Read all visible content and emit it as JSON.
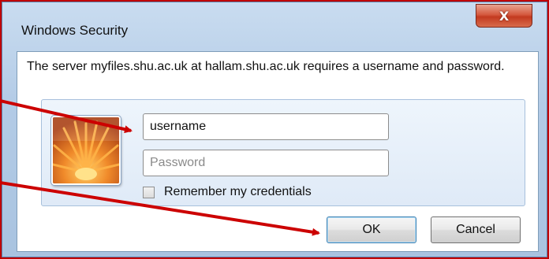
{
  "window": {
    "title": "Windows Security",
    "close_glyph": "X"
  },
  "message": "The server myfiles.shu.ac.uk at hallam.shu.ac.uk requires a username and password.",
  "credentials": {
    "avatar_icon": "user-tile-flower-icon",
    "username_value": "username",
    "password_placeholder": "Password",
    "remember_label": "Remember my credentials",
    "remember_checked": false
  },
  "buttons": {
    "ok_label": "OK",
    "cancel_label": "Cancel"
  },
  "colors": {
    "annotation_arrow": "#cc0000",
    "frame_border": "#c00000",
    "close_button": "#d5593f"
  }
}
